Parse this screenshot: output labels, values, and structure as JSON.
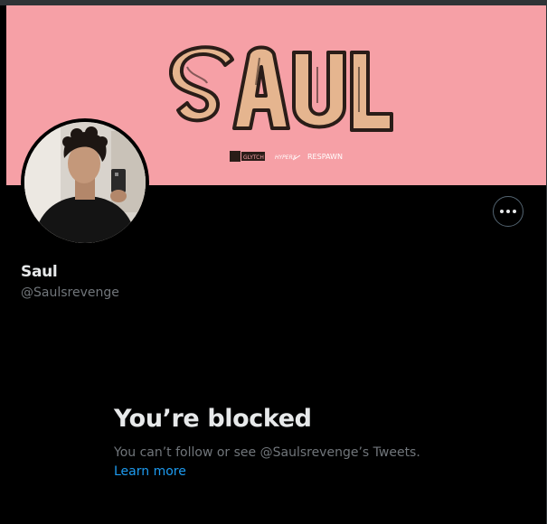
{
  "profile": {
    "display_name": "Saul",
    "handle": "@Saulsrevenge"
  },
  "banner": {
    "logo_text": "SAUL",
    "sponsors": [
      "GLYTCH",
      "HYPERX",
      "RESPAWN"
    ],
    "background_color": "#f6a0a6"
  },
  "actions": {
    "more_icon": "more-horizontal-icon"
  },
  "blocked": {
    "title": "You’re blocked",
    "message": "You can’t follow or see @Saulsrevenge’s Tweets.",
    "link": "Learn more"
  },
  "colors": {
    "background": "#000000",
    "text_primary": "#e7e9ea",
    "text_secondary": "#71767b",
    "link": "#1d9bf0"
  }
}
